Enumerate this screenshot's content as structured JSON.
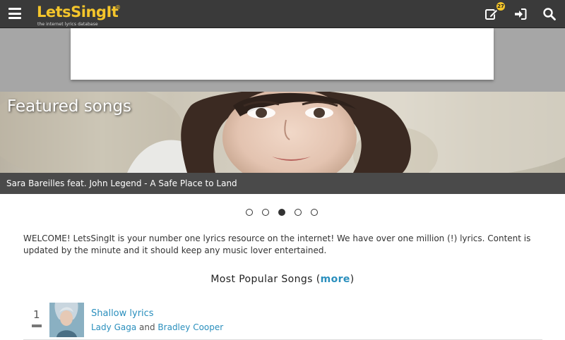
{
  "header": {
    "logo": "LetsSingIt",
    "logo_reg": "®",
    "tagline": "the internet lyrics database",
    "notification_count": "27",
    "icons": [
      "menu-icon",
      "edit-icon",
      "login-icon",
      "search-icon"
    ]
  },
  "featured": {
    "title": "Featured songs",
    "caption": "Sara Bareilles feat. John Legend - A Safe Place to Land",
    "slides": 5,
    "active_slide": 3
  },
  "welcome": "WELCOME! LetsSingIt is your number one lyrics resource on the internet! We have over one million (!) lyrics. Content is updated by the minute and it should keep any music lover entertained.",
  "popular": {
    "heading": "Most Popular Songs",
    "paren_open": " (",
    "more_label": "more",
    "paren_close": ")",
    "songs": [
      {
        "rank": "1",
        "title": "Shallow lyrics",
        "artist1": "Lady Gaga",
        "joiner": " and ",
        "artist2": "Bradley Cooper"
      }
    ]
  },
  "colors": {
    "topbar": "#3a3a3a",
    "brand": "#f4c52b",
    "link": "#2a8fbd",
    "page_bg": "#a6a6a6"
  }
}
